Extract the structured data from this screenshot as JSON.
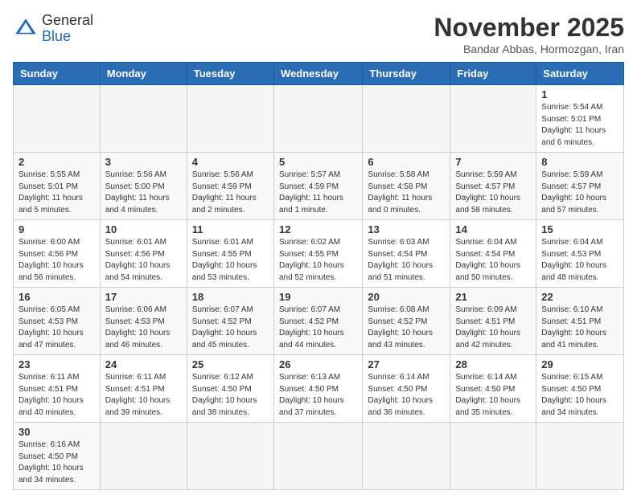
{
  "header": {
    "logo_general": "General",
    "logo_blue": "Blue",
    "month_title": "November 2025",
    "subtitle": "Bandar Abbas, Hormozgan, Iran"
  },
  "weekdays": [
    "Sunday",
    "Monday",
    "Tuesday",
    "Wednesday",
    "Thursday",
    "Friday",
    "Saturday"
  ],
  "weeks": [
    [
      {
        "day": "",
        "info": ""
      },
      {
        "day": "",
        "info": ""
      },
      {
        "day": "",
        "info": ""
      },
      {
        "day": "",
        "info": ""
      },
      {
        "day": "",
        "info": ""
      },
      {
        "day": "",
        "info": ""
      },
      {
        "day": "1",
        "info": "Sunrise: 5:54 AM\nSunset: 5:01 PM\nDaylight: 11 hours\nand 6 minutes."
      }
    ],
    [
      {
        "day": "2",
        "info": "Sunrise: 5:55 AM\nSunset: 5:01 PM\nDaylight: 11 hours\nand 5 minutes."
      },
      {
        "day": "3",
        "info": "Sunrise: 5:56 AM\nSunset: 5:00 PM\nDaylight: 11 hours\nand 4 minutes."
      },
      {
        "day": "4",
        "info": "Sunrise: 5:56 AM\nSunset: 4:59 PM\nDaylight: 11 hours\nand 2 minutes."
      },
      {
        "day": "5",
        "info": "Sunrise: 5:57 AM\nSunset: 4:59 PM\nDaylight: 11 hours\nand 1 minute."
      },
      {
        "day": "6",
        "info": "Sunrise: 5:58 AM\nSunset: 4:58 PM\nDaylight: 11 hours\nand 0 minutes."
      },
      {
        "day": "7",
        "info": "Sunrise: 5:59 AM\nSunset: 4:57 PM\nDaylight: 10 hours\nand 58 minutes."
      },
      {
        "day": "8",
        "info": "Sunrise: 5:59 AM\nSunset: 4:57 PM\nDaylight: 10 hours\nand 57 minutes."
      }
    ],
    [
      {
        "day": "9",
        "info": "Sunrise: 6:00 AM\nSunset: 4:56 PM\nDaylight: 10 hours\nand 56 minutes."
      },
      {
        "day": "10",
        "info": "Sunrise: 6:01 AM\nSunset: 4:56 PM\nDaylight: 10 hours\nand 54 minutes."
      },
      {
        "day": "11",
        "info": "Sunrise: 6:01 AM\nSunset: 4:55 PM\nDaylight: 10 hours\nand 53 minutes."
      },
      {
        "day": "12",
        "info": "Sunrise: 6:02 AM\nSunset: 4:55 PM\nDaylight: 10 hours\nand 52 minutes."
      },
      {
        "day": "13",
        "info": "Sunrise: 6:03 AM\nSunset: 4:54 PM\nDaylight: 10 hours\nand 51 minutes."
      },
      {
        "day": "14",
        "info": "Sunrise: 6:04 AM\nSunset: 4:54 PM\nDaylight: 10 hours\nand 50 minutes."
      },
      {
        "day": "15",
        "info": "Sunrise: 6:04 AM\nSunset: 4:53 PM\nDaylight: 10 hours\nand 48 minutes."
      }
    ],
    [
      {
        "day": "16",
        "info": "Sunrise: 6:05 AM\nSunset: 4:53 PM\nDaylight: 10 hours\nand 47 minutes."
      },
      {
        "day": "17",
        "info": "Sunrise: 6:06 AM\nSunset: 4:53 PM\nDaylight: 10 hours\nand 46 minutes."
      },
      {
        "day": "18",
        "info": "Sunrise: 6:07 AM\nSunset: 4:52 PM\nDaylight: 10 hours\nand 45 minutes."
      },
      {
        "day": "19",
        "info": "Sunrise: 6:07 AM\nSunset: 4:52 PM\nDaylight: 10 hours\nand 44 minutes."
      },
      {
        "day": "20",
        "info": "Sunrise: 6:08 AM\nSunset: 4:52 PM\nDaylight: 10 hours\nand 43 minutes."
      },
      {
        "day": "21",
        "info": "Sunrise: 6:09 AM\nSunset: 4:51 PM\nDaylight: 10 hours\nand 42 minutes."
      },
      {
        "day": "22",
        "info": "Sunrise: 6:10 AM\nSunset: 4:51 PM\nDaylight: 10 hours\nand 41 minutes."
      }
    ],
    [
      {
        "day": "23",
        "info": "Sunrise: 6:11 AM\nSunset: 4:51 PM\nDaylight: 10 hours\nand 40 minutes."
      },
      {
        "day": "24",
        "info": "Sunrise: 6:11 AM\nSunset: 4:51 PM\nDaylight: 10 hours\nand 39 minutes."
      },
      {
        "day": "25",
        "info": "Sunrise: 6:12 AM\nSunset: 4:50 PM\nDaylight: 10 hours\nand 38 minutes."
      },
      {
        "day": "26",
        "info": "Sunrise: 6:13 AM\nSunset: 4:50 PM\nDaylight: 10 hours\nand 37 minutes."
      },
      {
        "day": "27",
        "info": "Sunrise: 6:14 AM\nSunset: 4:50 PM\nDaylight: 10 hours\nand 36 minutes."
      },
      {
        "day": "28",
        "info": "Sunrise: 6:14 AM\nSunset: 4:50 PM\nDaylight: 10 hours\nand 35 minutes."
      },
      {
        "day": "29",
        "info": "Sunrise: 6:15 AM\nSunset: 4:50 PM\nDaylight: 10 hours\nand 34 minutes."
      }
    ],
    [
      {
        "day": "30",
        "info": "Sunrise: 6:16 AM\nSunset: 4:50 PM\nDaylight: 10 hours\nand 34 minutes."
      },
      {
        "day": "",
        "info": ""
      },
      {
        "day": "",
        "info": ""
      },
      {
        "day": "",
        "info": ""
      },
      {
        "day": "",
        "info": ""
      },
      {
        "day": "",
        "info": ""
      },
      {
        "day": "",
        "info": ""
      }
    ]
  ]
}
